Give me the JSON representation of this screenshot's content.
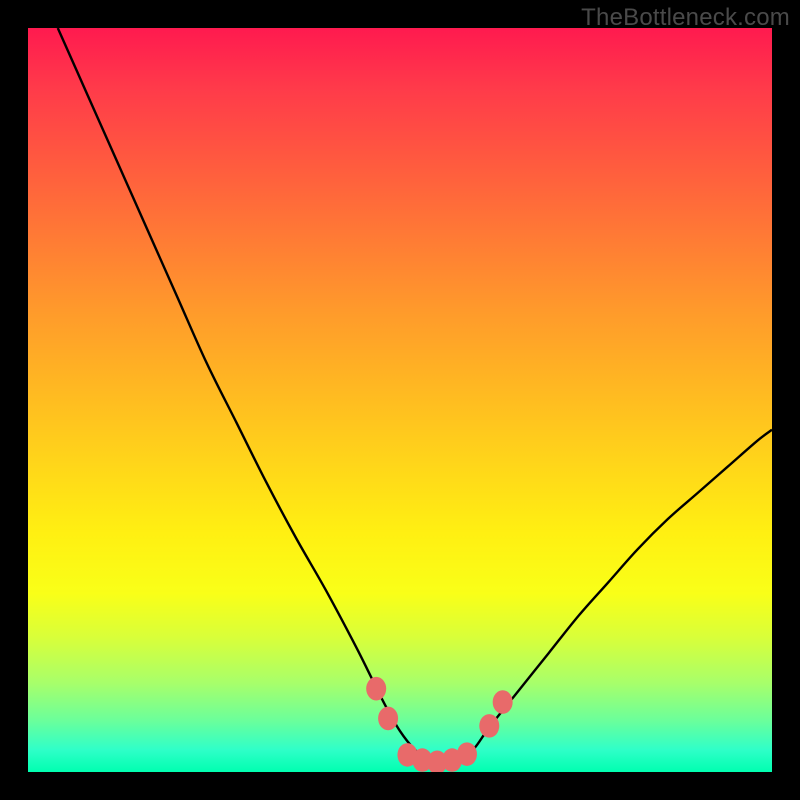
{
  "watermark": "TheBottleneck.com",
  "chart_data": {
    "type": "line",
    "title": "",
    "xlabel": "",
    "ylabel": "",
    "xlim": [
      0,
      100
    ],
    "ylim": [
      0,
      100
    ],
    "series": [
      {
        "name": "bottleneck-curve",
        "x": [
          4,
          8,
          12,
          16,
          20,
          24,
          28,
          32,
          36,
          40,
          44,
          46,
          48,
          50,
          52,
          54,
          56,
          58,
          60,
          62,
          66,
          70,
          74,
          78,
          82,
          86,
          90,
          94,
          98,
          100
        ],
        "values": [
          100,
          91,
          82,
          73,
          64,
          55,
          47,
          39,
          31.5,
          24.5,
          17,
          13,
          9,
          5.5,
          3,
          1.5,
          1,
          1.5,
          3.2,
          6,
          11,
          16,
          21,
          25.5,
          30,
          34,
          37.5,
          41,
          44.5,
          46
        ]
      }
    ],
    "markers": [
      {
        "name": "left-outer",
        "x": 46.8,
        "y": 11.2
      },
      {
        "name": "left-mid",
        "x": 48.4,
        "y": 7.2
      },
      {
        "name": "floor-1",
        "x": 51.0,
        "y": 2.3
      },
      {
        "name": "floor-2",
        "x": 53.0,
        "y": 1.6
      },
      {
        "name": "floor-3",
        "x": 55.0,
        "y": 1.3
      },
      {
        "name": "floor-4",
        "x": 57.0,
        "y": 1.6
      },
      {
        "name": "floor-5",
        "x": 59.0,
        "y": 2.4
      },
      {
        "name": "right-mid",
        "x": 62.0,
        "y": 6.2
      },
      {
        "name": "right-outer",
        "x": 63.8,
        "y": 9.4
      }
    ],
    "marker_radius": 10,
    "marker_color": "#e86a6a",
    "curve_color": "#000000"
  }
}
